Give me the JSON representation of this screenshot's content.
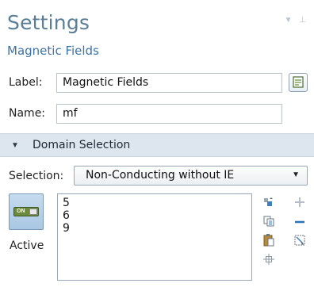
{
  "header": {
    "title": "Settings",
    "subtitle": "Magnetic Fields"
  },
  "form": {
    "label_caption": "Label:",
    "label_value": "Magnetic Fields",
    "name_caption": "Name:",
    "name_value": "mf"
  },
  "section": {
    "title": "Domain Selection"
  },
  "selection": {
    "caption": "Selection:",
    "value": "Non-Conducting without IE"
  },
  "active": {
    "toggle_text": "ON",
    "label": "Active"
  },
  "domains": [
    "5",
    "6",
    "9"
  ],
  "toolbar": {
    "icons": [
      "paste-selection-icon",
      "add-icon",
      "copy-icon",
      "remove-icon",
      "clipboard-icon",
      "clear-selection-icon",
      "zoom-to-selection-icon"
    ]
  },
  "colors": {
    "title": "#5b7e97",
    "subtitle": "#3d73a8",
    "section_bg": "#dde6ee",
    "toggle_green": "#6b8a3a"
  }
}
